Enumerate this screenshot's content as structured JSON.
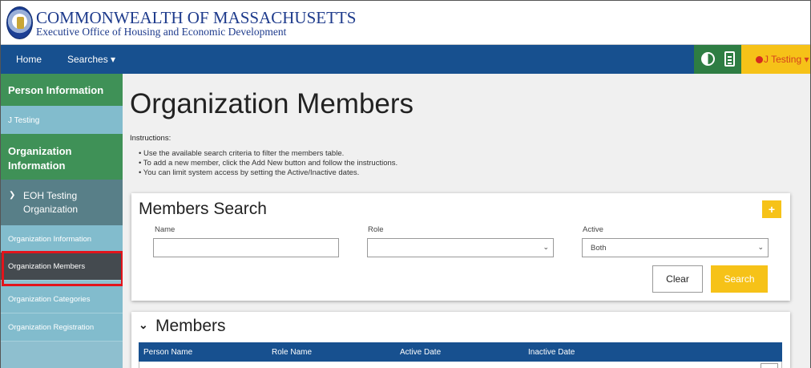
{
  "header": {
    "title": "COMMONWEALTH OF MASSACHUSETTS",
    "subtitle": "Executive Office of Housing and Economic Development"
  },
  "navbar": {
    "home": "Home",
    "searches": "Searches ▾",
    "user": "J Testing ▾",
    "colors": {
      "nav": "#17508f",
      "green": "#2e7d43",
      "accent": "#f6c218"
    }
  },
  "sidebar": {
    "person_heading": "Person Information",
    "person_name": "J Testing",
    "org_heading_line1": "Organization",
    "org_heading_line2": "Information",
    "org_name_line1": "EOH Testing",
    "org_name_line2": "Organization",
    "items": [
      {
        "label": "Organization Information"
      },
      {
        "label": "Organization Members"
      },
      {
        "label": "Organization Categories"
      },
      {
        "label": "Organization Registration"
      }
    ]
  },
  "main": {
    "title": "Organization Members",
    "instructions_heading": "Instructions:",
    "instructions": [
      "Use the available search criteria to filter the members table.",
      "To add a new member, click the Add New button and follow the instructions.",
      "You can limit system access by setting the Active/Inactive dates."
    ]
  },
  "search": {
    "title": "Members Search",
    "add_label": "+",
    "name_label": "Name",
    "name_value": "",
    "role_label": "Role",
    "role_value": "",
    "active_label": "Active",
    "active_value": "Both",
    "clear_label": "Clear",
    "search_label": "Search"
  },
  "members": {
    "title": "Members",
    "columns": [
      "Person Name",
      "Role Name",
      "Active Date",
      "Inactive Date"
    ]
  }
}
